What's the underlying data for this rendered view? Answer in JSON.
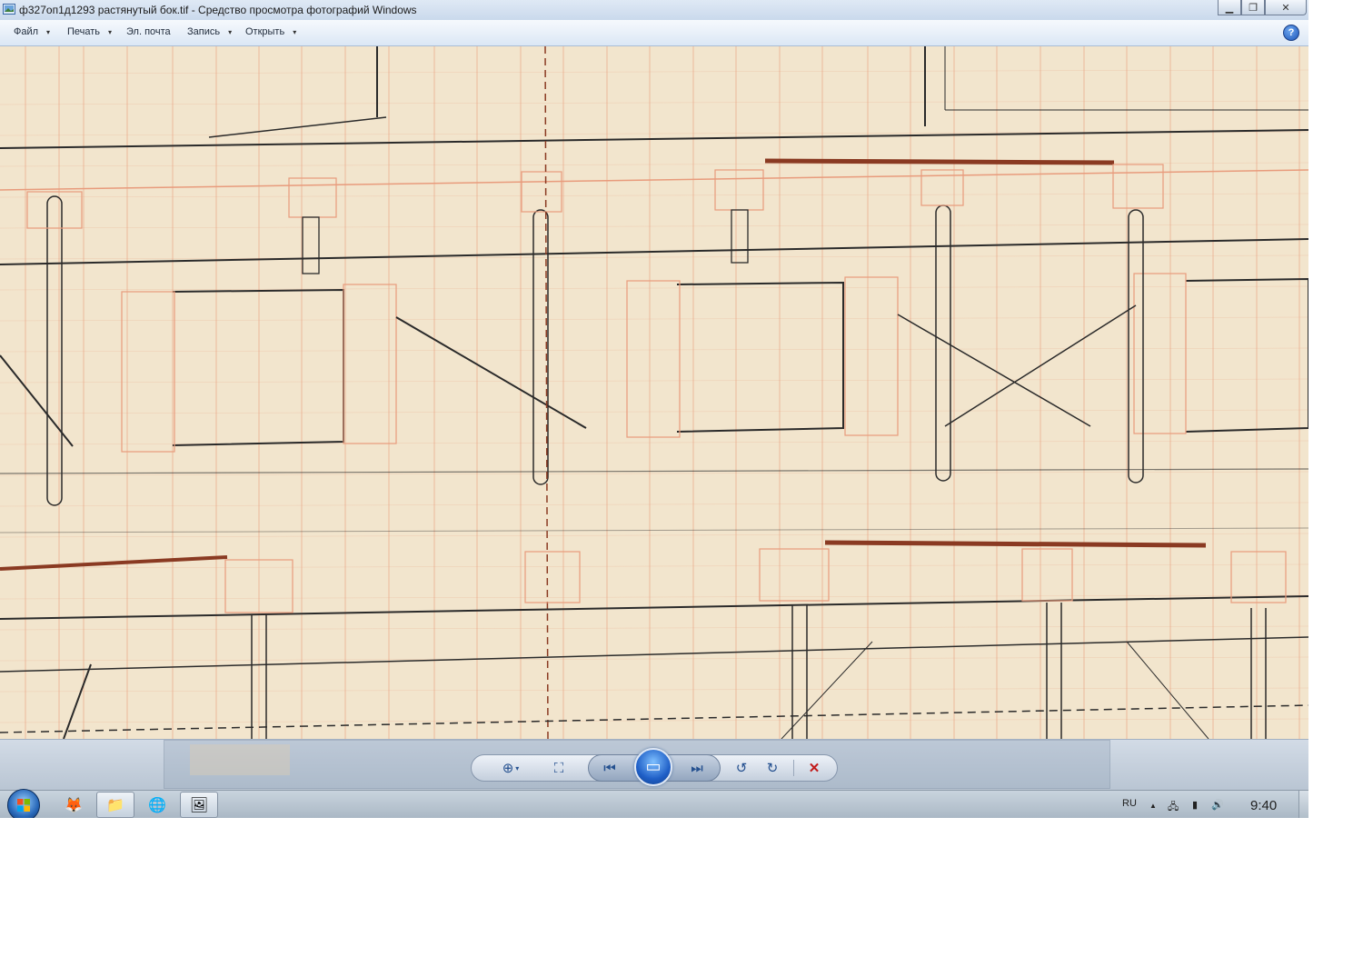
{
  "window": {
    "title": "ф327оп1д1293 растянутый бок.tif - Средство просмотра фотографий Windows",
    "minimize_glyph": "▁",
    "maximize_glyph": "❐",
    "close_glyph": "✕"
  },
  "menu": {
    "items": [
      {
        "label": "Файл",
        "has_dropdown": true
      },
      {
        "label": "Печать",
        "has_dropdown": true
      },
      {
        "label": "Эл. почта",
        "has_dropdown": false
      },
      {
        "label": "Запись",
        "has_dropdown": true
      },
      {
        "label": "Открыть",
        "has_dropdown": true
      }
    ],
    "caret": "▾",
    "help_glyph": "?"
  },
  "image": {
    "description_icon": "scanned-ship-drawing",
    "paper_color": "#f2e5cd",
    "grid_color": "#e89b7c",
    "ink_color": "#2a2a2a",
    "brown_ink_color": "#8a3a22"
  },
  "controls": {
    "zoom_glyph": "⊕",
    "fit_glyph": "⛶",
    "prev_glyph": "⏮",
    "slideshow_glyph": "▭",
    "next_glyph": "⏭",
    "rotate_ccw_glyph": "↺",
    "rotate_cw_glyph": "↻",
    "delete_glyph": "✕"
  },
  "taskbar": {
    "language": "RU",
    "clock": "9:40",
    "tray_up_glyph": "▲",
    "network_glyph": "🖧",
    "signal_glyph": "▮",
    "volume_glyph": "🔊",
    "apps": [
      {
        "name": "firefox-icon",
        "glyph": "🦊",
        "active": false
      },
      {
        "name": "explorer-icon",
        "glyph": "📁",
        "active": true
      },
      {
        "name": "network-app-icon",
        "glyph": "🌐",
        "active": false
      },
      {
        "name": "photo-viewer-icon",
        "glyph": "🖼",
        "active": true
      }
    ]
  }
}
